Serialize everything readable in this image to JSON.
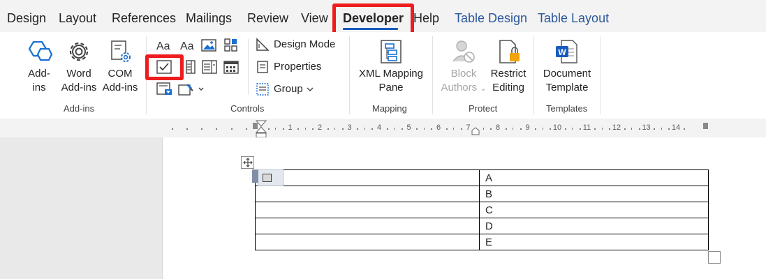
{
  "tabs": [
    "Design",
    "Layout",
    "References",
    "Mailings",
    "Review",
    "View",
    "Developer",
    "Help",
    "Table Design",
    "Table Layout"
  ],
  "active_tab": "Developer",
  "ribbon": {
    "addins": {
      "group_label": "Add-ins",
      "buttons": [
        {
          "line1": "Add-",
          "line2": "ins",
          "icon": "hexagon-addins-icon"
        },
        {
          "line1": "Word",
          "line2": "Add-ins",
          "icon": "gear-icon"
        },
        {
          "line1": "COM",
          "line2": "Add-ins",
          "icon": "com-addins-gear-icon"
        }
      ]
    },
    "controls": {
      "group_label": "Controls",
      "design_mode": "Design Mode",
      "properties": "Properties",
      "group": "Group",
      "icons": [
        "rich-text-content-control-icon",
        "plain-text-content-control-icon",
        "picture-content-control-icon",
        "building-block-gallery-icon",
        "checkbox-content-control-icon",
        "combo-box-icon",
        "dropdown-list-icon",
        "date-picker-icon",
        "legacy-forms-icon",
        "legacy-tools-icon"
      ]
    },
    "mapping": {
      "group_label": "Mapping",
      "xml_line1": "XML Mapping",
      "xml_line2": "Pane"
    },
    "protect": {
      "group_label": "Protect",
      "block_line1": "Block",
      "block_line2": "Authors",
      "restrict_line1": "Restrict",
      "restrict_line2": "Editing"
    },
    "templates": {
      "group_label": "Templates",
      "doc_line1": "Document",
      "doc_line2": "Template"
    }
  },
  "ruler": {
    "numbers": [
      "1",
      "2",
      "3",
      "4",
      "5",
      "6",
      "7",
      "8",
      "9",
      "10",
      "11",
      "12",
      "13",
      "14"
    ]
  },
  "table": {
    "rows": [
      {
        "col1": "",
        "col2": "A"
      },
      {
        "col1": "",
        "col2": "B"
      },
      {
        "col1": "",
        "col2": "C"
      },
      {
        "col1": "",
        "col2": "D"
      },
      {
        "col1": "",
        "col2": "E"
      }
    ]
  },
  "colors": {
    "highlight_box": "#ee1c1c",
    "accent_blue": "#2b579a",
    "active_underline": "#185abd"
  }
}
